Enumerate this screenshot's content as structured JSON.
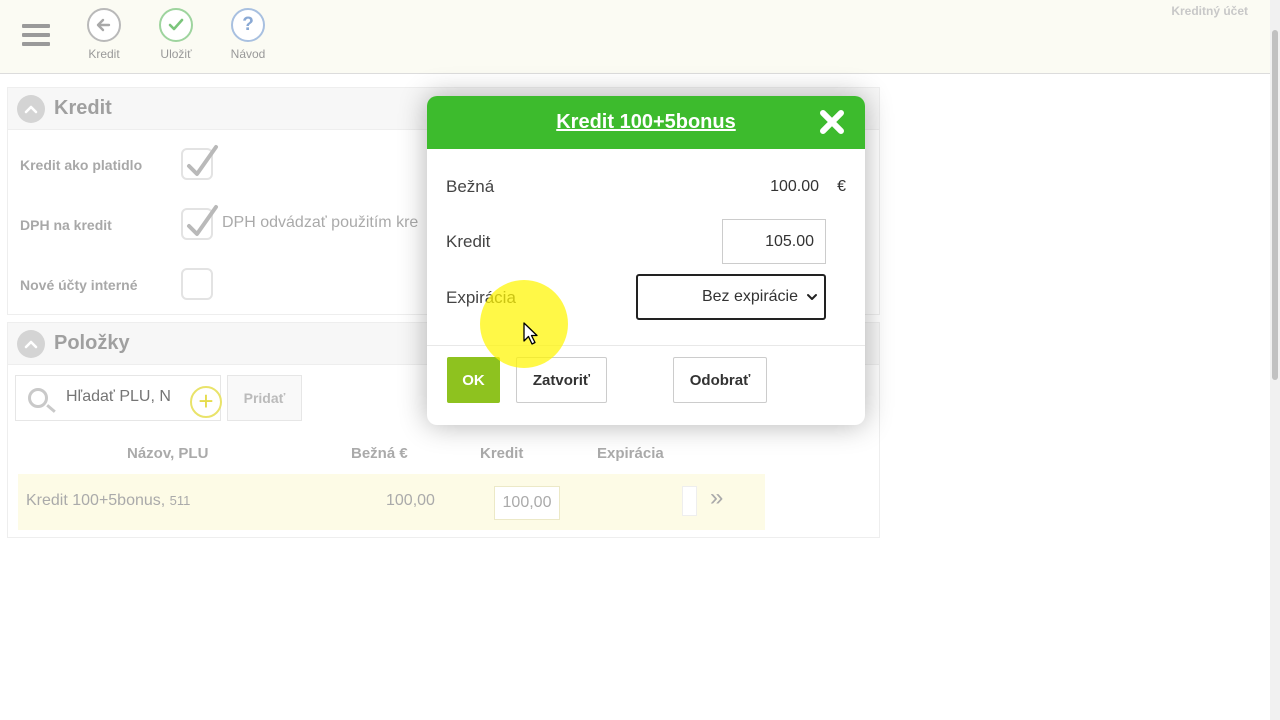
{
  "toolbar": {
    "menu_icon": "hamburger-icon",
    "buttons": [
      {
        "label": "Kredit",
        "icon": "arrow-left-icon"
      },
      {
        "label": "Uložiť",
        "icon": "check-icon"
      },
      {
        "label": "Návod",
        "icon": "question-icon"
      }
    ],
    "account_title": "Kreditný účet"
  },
  "kredit_panel": {
    "title": "Kredit",
    "fields": [
      {
        "label": "Kredit ako platidlo",
        "checked": true
      },
      {
        "label": "DPH na kredit",
        "checked": true,
        "note": "DPH odvádzať použitím kre"
      },
      {
        "label": "Nové účty interné",
        "checked": false
      }
    ]
  },
  "polozky_panel": {
    "title": "Položky",
    "search_placeholder": "Hľadať PLU, N",
    "add_label": "Pridať",
    "columns": [
      "Názov, PLU",
      "Bežná €",
      "Kredit",
      "Expirácia"
    ],
    "rows": [
      {
        "name": "Kredit 100+5bonus,",
        "plu": "511",
        "price": "100,00",
        "credit": "100,00",
        "more": "»"
      }
    ]
  },
  "modal": {
    "title": "Kredit 100+5bonus",
    "normal_label": "Bežná",
    "normal_value": "100.00",
    "currency": "€",
    "credit_label": "Kredit",
    "credit_value": "105.00",
    "expiration_label": "Expirácia",
    "expiration_value": "Bez expirácie",
    "ok_label": "OK",
    "close_label": "Zatvoriť",
    "remove_label": "Odobrať"
  },
  "colors": {
    "modal_header": "#3dbb2d",
    "ok_button": "#8ec21f",
    "row_highlight": "#fdfbe6",
    "cursor_halo": "#fff500"
  }
}
